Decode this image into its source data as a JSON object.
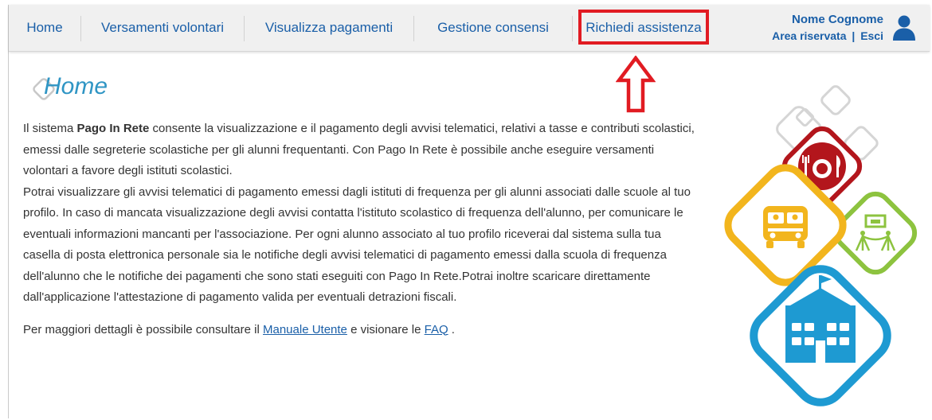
{
  "nav": {
    "items": [
      {
        "label": "Home"
      },
      {
        "label": "Versamenti volontari"
      },
      {
        "label": "Visualizza pagamenti"
      },
      {
        "label": "Gestione consensi"
      },
      {
        "label": "Richiedi assistenza"
      }
    ]
  },
  "user": {
    "name": "Nome Cognome",
    "area_label": "Area riservata",
    "separator": "|",
    "logout_label": "Esci"
  },
  "page": {
    "title": "Home",
    "intro_before": "Il sistema ",
    "intro_bold": "Pago In Rete",
    "intro_after": " consente la visualizzazione e il pagamento degli avvisi telematici, relativi a tasse e contributi scolastici, emessi dalle segreterie scolastiche per gli alunni frequentanti. Con Pago In Rete è possibile anche eseguire versamenti volontari a favore degli istituti scolastici.",
    "body": "Potrai visualizzare gli avvisi telematici di pagamento emessi dagli istituti di frequenza per gli alunni associati dalle scuole al tuo profilo. In caso di mancata visualizzazione degli avvisi contatta l'istituto scolastico di frequenza dell'alunno, per comunicare le eventuali informazioni mancanti per l'associazione. Per ogni alunno associato al tuo profilo riceverai dal sistema sulla tua casella di posta elettronica personale sia le notifiche degli avvisi telematici di pagamento emessi dalla scuola di frequenza dell'alunno che le notifiche dei pagamenti che sono stati eseguiti con Pago In Rete.Potrai inoltre scaricare direttamente dall'applicazione l'attestazione di pagamento valida per eventuali detrazioni fiscali.",
    "footer_before": "Per maggiori dettagli è possibile consultare il ",
    "manual_link": "Manuale Utente",
    "footer_middle": " e visionare le ",
    "faq_link": "FAQ",
    "footer_after": " ."
  },
  "colors": {
    "nav_link": "#1a5fa8",
    "title": "#2f95c4",
    "highlight": "#e11b22",
    "tile_red": "#b3161c",
    "tile_yellow": "#f2b51d",
    "tile_green": "#8dc33f",
    "tile_blue": "#1e9ad2"
  },
  "icons": {
    "avatar": "user-icon",
    "arrow": "arrow-up-icon",
    "tiles": [
      "cutlery-plate-icon",
      "school-bus-icon",
      "museum-icon",
      "school-building-icon"
    ]
  }
}
